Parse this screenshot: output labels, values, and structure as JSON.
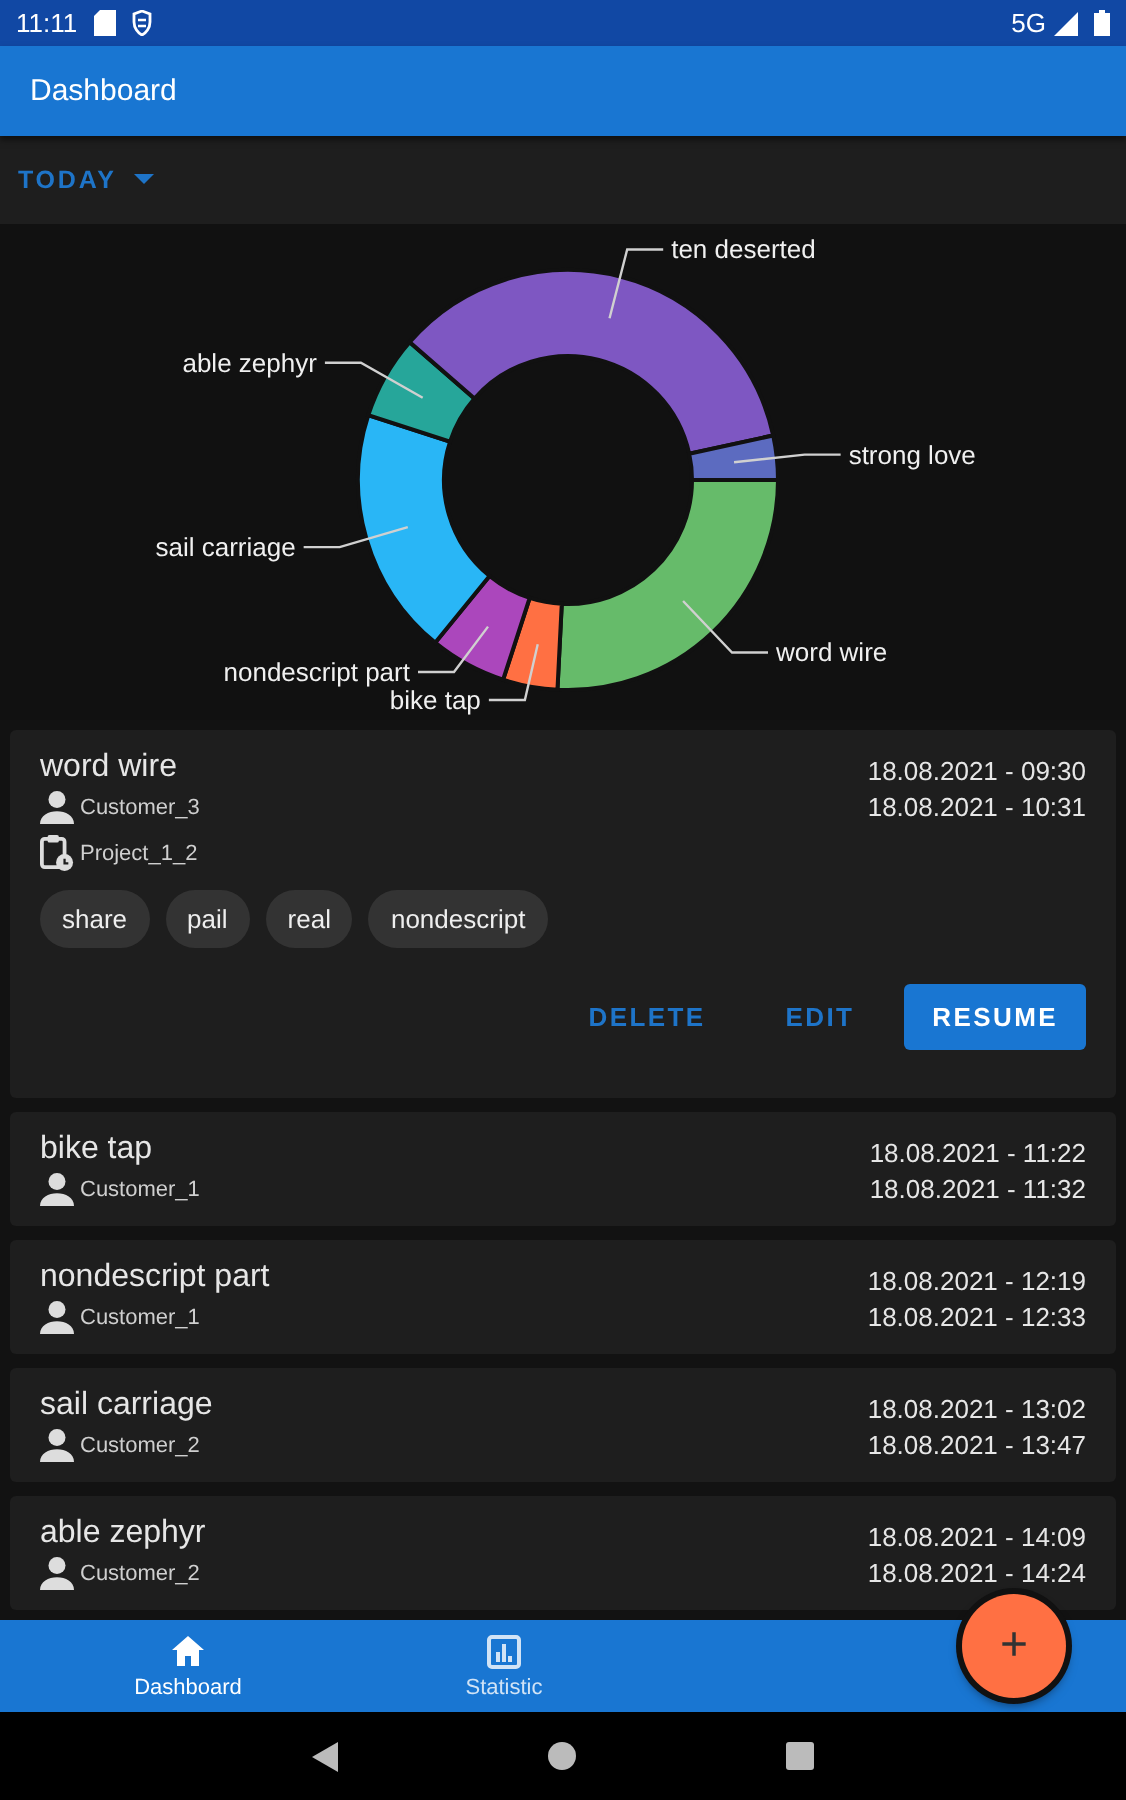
{
  "status_bar": {
    "time": "11:11",
    "network": "5G"
  },
  "app_bar": {
    "title": "Dashboard"
  },
  "filter": {
    "label": "TODAY"
  },
  "chart": {
    "chart_data": {
      "type": "donut",
      "categories": [
        "word wire",
        "bike tap",
        "nondescript part",
        "sail carriage",
        "able zephyr",
        "ten deserted",
        "strong love"
      ],
      "colors": [
        "#66bb6a",
        "#ff7043",
        "#ab47bc",
        "#29b6f6",
        "#26a69a",
        "#7e57c2",
        "#5c6bc0"
      ],
      "values": [
        25.8,
        4.2,
        5.9,
        19.1,
        6.4,
        35.2,
        3.4
      ]
    }
  },
  "entries": [
    {
      "title": "word wire",
      "start": "18.08.2021 - 09:30",
      "end": "18.08.2021 - 10:31",
      "customer": "Customer_3",
      "project": "Project_1_2",
      "tags": [
        "share",
        "pail",
        "real",
        "nondescript"
      ],
      "actions": [
        {
          "label": "DELETE",
          "kind": "text"
        },
        {
          "label": "EDIT",
          "kind": "text"
        },
        {
          "label": "RESUME",
          "kind": "filled"
        }
      ]
    },
    {
      "title": "bike tap",
      "start": "18.08.2021 - 11:22",
      "end": "18.08.2021 - 11:32",
      "customer": "Customer_1"
    },
    {
      "title": "nondescript part",
      "start": "18.08.2021 - 12:19",
      "end": "18.08.2021 - 12:33",
      "customer": "Customer_1"
    },
    {
      "title": "sail carriage",
      "start": "18.08.2021 - 13:02",
      "end": "18.08.2021 - 13:47",
      "customer": "Customer_2"
    },
    {
      "title": "able zephyr",
      "start": "18.08.2021 - 14:09",
      "end": "18.08.2021 - 14:24",
      "customer": "Customer_2"
    }
  ],
  "bottom_nav": {
    "tabs": [
      {
        "label": "Dashboard",
        "kind": "home",
        "selected": true
      },
      {
        "label": "Statistic",
        "kind": "chart",
        "selected": false
      }
    ]
  },
  "fab": {
    "label": "+"
  }
}
